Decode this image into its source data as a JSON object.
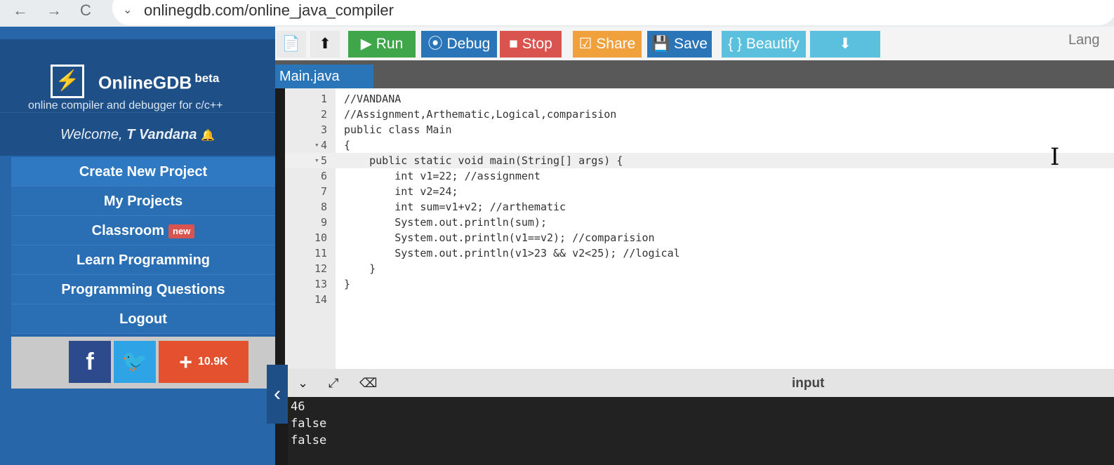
{
  "browser": {
    "url": "onlinegdb.com/online_java_compiler",
    "back": "←",
    "forward": "→",
    "reload": "C"
  },
  "sidebar": {
    "logo_glyph": "⚡",
    "brand_name": "OnlineGDB",
    "brand_beta": "beta",
    "tagline": "online compiler and debugger for c/c++",
    "welcome_prefix": "Welcome, ",
    "welcome_user": "T Vandana",
    "bell_glyph": "🔔",
    "menu": [
      {
        "label": "Create New Project"
      },
      {
        "label": "My Projects"
      },
      {
        "label": "Classroom",
        "badge": "new"
      },
      {
        "label": "Learn Programming"
      },
      {
        "label": "Programming Questions"
      },
      {
        "label": "Logout"
      }
    ],
    "social": {
      "facebook_glyph": "f",
      "twitter_glyph": "🐦",
      "plus_glyph": "+",
      "share_count": "10.9K"
    }
  },
  "toolbar": {
    "file_glyph": "📄",
    "upload_glyph": "⬆",
    "run": "▶ Run",
    "debug": "⦿ Debug",
    "stop": "■ Stop",
    "share": "☑ Share",
    "save": "💾 Save",
    "beautify": "{ } Beautify",
    "download_glyph": "⬇",
    "language_label": "Lang"
  },
  "editor": {
    "tab": "Main.java",
    "lines": [
      {
        "n": "1",
        "fold": "",
        "code": "//VANDANA"
      },
      {
        "n": "2",
        "fold": "",
        "code": "//Assignment,Arthematic,Logical,comparision"
      },
      {
        "n": "3",
        "fold": "",
        "code": "public class Main"
      },
      {
        "n": "4",
        "fold": "▾",
        "code": "{"
      },
      {
        "n": "5",
        "fold": "▾",
        "code": "    public static void main(String[] args) {"
      },
      {
        "n": "6",
        "fold": "",
        "code": "        int v1=22; //assignment"
      },
      {
        "n": "7",
        "fold": "",
        "code": "        int v2=24;"
      },
      {
        "n": "8",
        "fold": "",
        "code": "        int sum=v1+v2; //arthematic"
      },
      {
        "n": "9",
        "fold": "",
        "code": "        System.out.println(sum);"
      },
      {
        "n": "10",
        "fold": "",
        "code": "        System.out.println(v1==v2); //comparision"
      },
      {
        "n": "11",
        "fold": "",
        "code": "        System.out.println(v1>23 && v2<25); //logical"
      },
      {
        "n": "12",
        "fold": "",
        "code": "    }"
      },
      {
        "n": "13",
        "fold": "",
        "code": "}"
      },
      {
        "n": "14",
        "fold": "",
        "code": ""
      }
    ],
    "active_line": 5
  },
  "output": {
    "collapse_glyph": "‹",
    "chevron_glyph": "⌄",
    "expand_glyph": "⤢",
    "clear_glyph": "⌫",
    "input_label": "input",
    "lines": [
      "46",
      "false",
      "false"
    ]
  },
  "colors": {
    "sidebar": "#2766a8",
    "run": "#3fa64a",
    "stop": "#d9534f",
    "share": "#f0a13c",
    "beautify": "#5bc0de"
  }
}
